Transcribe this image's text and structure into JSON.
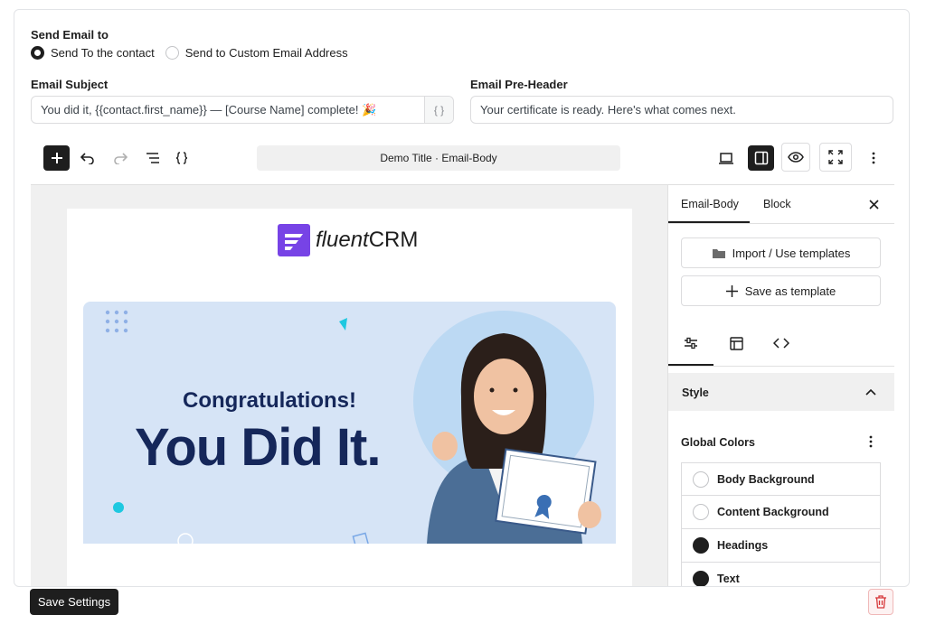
{
  "send_to": {
    "label": "Send Email to",
    "options": [
      {
        "label": "Send To the contact",
        "selected": true
      },
      {
        "label": "Send to Custom Email Address",
        "selected": false
      }
    ]
  },
  "subject": {
    "label": "Email Subject",
    "value": "You did it, {{contact.first_name}} — [Course Name] complete! 🎉",
    "addon": "{ }"
  },
  "preheader": {
    "label": "Email Pre-Header",
    "value": "Your certificate is ready. Here's what comes next."
  },
  "editor": {
    "doc_title": "Demo Title · Email-Body"
  },
  "email": {
    "logo_text_1": "fluent",
    "logo_text_2": "CRM",
    "hero_sub": "Congratulations!",
    "hero_main": "You Did It."
  },
  "sidebar": {
    "tabs": [
      "Email-Body",
      "Block"
    ],
    "active_tab": "Email-Body",
    "import_label": "Import / Use templates",
    "save_template_label": "Save as template",
    "style_label": "Style",
    "global_colors_label": "Global Colors",
    "colors": [
      {
        "label": "Body Background",
        "color": "#ffffff"
      },
      {
        "label": "Content Background",
        "color": "#ffffff"
      },
      {
        "label": "Headings",
        "color": "#1e1e1e"
      },
      {
        "label": "Text",
        "color": "#1e1e1e"
      }
    ]
  },
  "footer": {
    "save_label": "Save Settings"
  },
  "colors": {
    "brand_purple": "#7743e6",
    "hero_bg": "#d6e4f6",
    "hero_text": "#15275a",
    "danger": "#d63638"
  }
}
